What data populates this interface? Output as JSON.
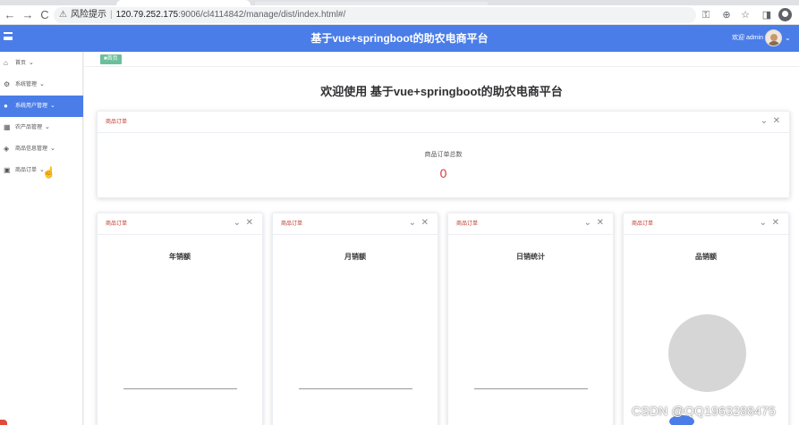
{
  "browser": {
    "back_icon": "←",
    "forward_icon": "→",
    "reload_icon": "C",
    "security_label": "风险提示",
    "url_host": "120.79.252.175",
    "url_path": ":9006/cl4114842/manage/dist/index.html#/",
    "key_icon": "⚿",
    "zoom_icon": "⊕",
    "star_icon": "☆",
    "sidepanel_icon": "◨"
  },
  "header": {
    "title": "基于vue+springboot的助农电商平台",
    "user": "欢迎 admin",
    "chevron": "⌄"
  },
  "sidebar": {
    "items": [
      {
        "label": "首页",
        "icon": "⌂"
      },
      {
        "label": "系统管理",
        "icon": "⚙"
      },
      {
        "label": "系统用户管理",
        "icon": "●"
      },
      {
        "label": "农产品管理",
        "icon": "▦"
      },
      {
        "label": "商品信息管理",
        "icon": "◈"
      },
      {
        "label": "商品订单",
        "icon": "▣"
      }
    ],
    "caret": "⌄",
    "cursor_icon": "☝"
  },
  "breadcrumb": {
    "tag": "■首页"
  },
  "main": {
    "welcome": "欢迎使用 基于vue+springboot的助农电商平台",
    "summary_card": {
      "tag": "商品订单",
      "label": "商品订单总数",
      "value": "0",
      "collapse": "⌄",
      "close": "✕"
    },
    "chart_cards": [
      {
        "tag": "商品订单",
        "title": "年销额"
      },
      {
        "tag": "商品订单",
        "title": "月销额"
      },
      {
        "tag": "商品订单",
        "title": "日销统计"
      },
      {
        "tag": "商品订单",
        "title": "品销额"
      }
    ]
  },
  "watermark": "CSDN @QQ1963288475",
  "colors": {
    "accent": "#4a7de8",
    "tag_red": "#c0392b",
    "value_red": "#d9363e",
    "breadcrumb_green": "#6bbf9a",
    "pie_gray": "#d6d6d6"
  }
}
